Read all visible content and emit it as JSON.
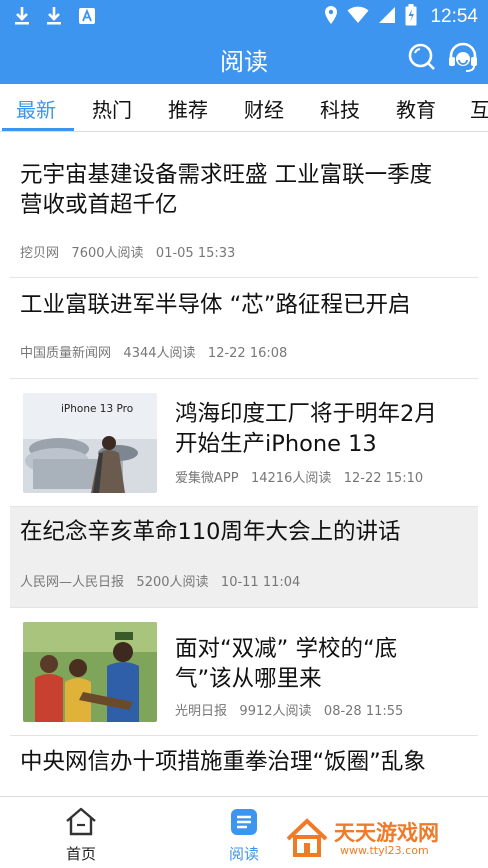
{
  "status_bar": {
    "time": "12:54"
  },
  "header": {
    "title": "阅读"
  },
  "tabs": [
    {
      "label": "最新"
    },
    {
      "label": "热门"
    },
    {
      "label": "推荐"
    },
    {
      "label": "财经"
    },
    {
      "label": "科技"
    },
    {
      "label": "教育"
    },
    {
      "label": "互"
    }
  ],
  "feed": [
    {
      "title_line1": "元宇宙基建设备需求旺盛 工业富联一季度",
      "title_line2": "营收或首超千亿",
      "source": "挖贝网",
      "reads": "7600人阅读",
      "time": "01-05 15:33"
    },
    {
      "title_line1": "工业富联进军半导体 “芯”路征程已开启",
      "source": "中国质量新闻网",
      "reads": "4344人阅读",
      "time": "12-22 16:08"
    },
    {
      "title_line1": "鸿海印度工厂将于明年2月",
      "title_line2": "开始生产iPhone 13",
      "source": "爱集微APP",
      "reads": "14216人阅读",
      "time": "12-22 15:10",
      "image_text": "iPhone 13 Pro"
    },
    {
      "title_line1": "在纪念辛亥革命110周年大会上的讲话",
      "source": "人民网—人民日报",
      "reads": "5200人阅读",
      "time": "10-11 11:04"
    },
    {
      "title_line1": "面对“双减” 学校的“底",
      "title_line2": "气”该从哪里来",
      "source": "光明日报",
      "reads": "9912人阅读",
      "time": "08-28 11:55"
    },
    {
      "title_line1": "中央网信办十项措施重拳治理“饭圈”乱象"
    }
  ],
  "bottom_nav": {
    "home_label": "首页",
    "read_label": "阅读"
  },
  "watermark": {
    "text": "天天游戏网",
    "url": "www.ttyl23.com"
  },
  "colors": {
    "accent": "#3d95ef",
    "watermark": "#f07a28"
  }
}
